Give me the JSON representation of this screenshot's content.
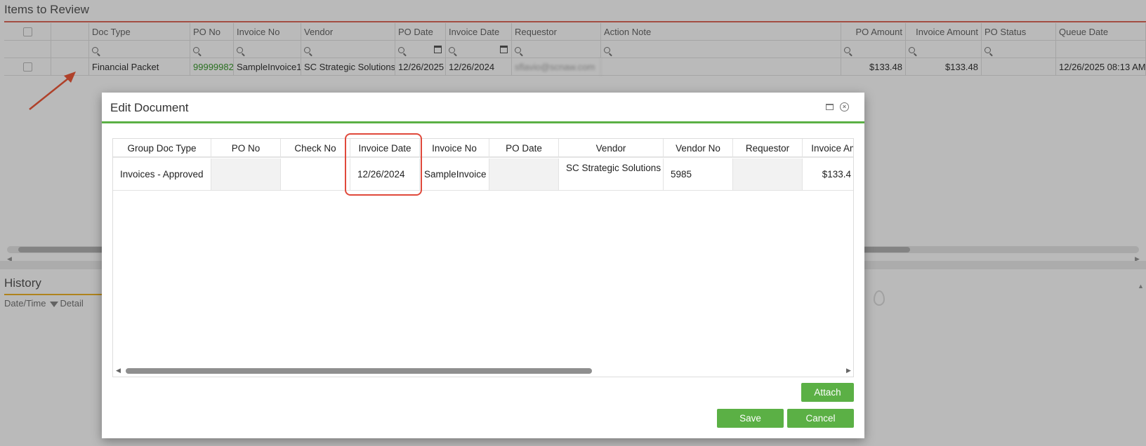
{
  "review": {
    "title": "Items to Review",
    "columns": [
      "Doc Type",
      "PO No",
      "Invoice No",
      "Vendor",
      "PO Date",
      "Invoice Date",
      "Requestor",
      "Action Note",
      "PO Amount",
      "Invoice Amount",
      "PO Status",
      "Queue Date"
    ],
    "row": {
      "doc_type": "Financial Packet",
      "po_no": "99999982",
      "invoice_no": "SampleInvoice1",
      "vendor": "SC Strategic Solutions",
      "po_date": "12/26/2025",
      "invoice_date": "12/26/2024",
      "requestor": "sflavio@scnaw.com",
      "action_note": "",
      "po_amount": "$133.48",
      "invoice_amount": "$133.48",
      "po_status": "",
      "queue_date": "12/26/2025 08:13 AM"
    }
  },
  "history": {
    "title": "History",
    "col_datetime": "Date/Time",
    "col_detail": "Detail"
  },
  "dialog": {
    "title": "Edit Document",
    "columns": [
      "Group Doc Type",
      "PO No",
      "Check No",
      "Invoice Date",
      "Invoice No",
      "PO Date",
      "Vendor",
      "Vendor No",
      "Requestor",
      "Invoice Amo"
    ],
    "row": {
      "group_doc_type": "Invoices - Approved",
      "po_no": "",
      "check_no": "",
      "invoice_date": "12/26/2024",
      "invoice_no": "SampleInvoice",
      "po_date": "",
      "vendor": "SC Strategic Solutions",
      "vendor_no": "5985",
      "requestor": "",
      "invoice_amount": "$133.4"
    },
    "buttons": {
      "attach": "Attach",
      "save": "Save",
      "cancel": "Cancel"
    }
  },
  "colors": {
    "accent_green": "#5bb045",
    "highlight_red": "#e0493b",
    "review_underline": "#e06a5b"
  }
}
